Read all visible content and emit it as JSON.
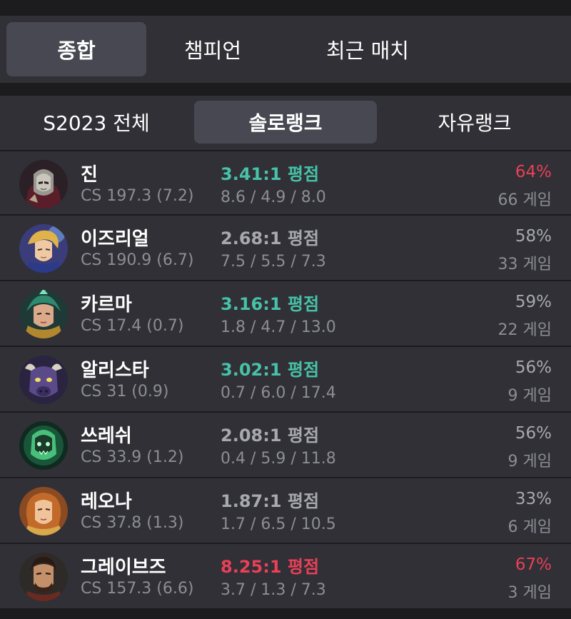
{
  "main_tabs": [
    {
      "label": "종합",
      "active": true
    },
    {
      "label": "챔피언",
      "active": false
    },
    {
      "label": "최근 매치",
      "active": false
    }
  ],
  "sub_tabs": [
    {
      "label": "S2023 전체",
      "active": false
    },
    {
      "label": "솔로랭크",
      "active": true
    },
    {
      "label": "자유랭크",
      "active": false
    }
  ],
  "colors": {
    "background": "#1c1c1f",
    "panel": "#303036",
    "active_tab": "#484852",
    "kda_good": "#47c1a8",
    "kda_great": "#e84057",
    "winrate_high": "#e84057",
    "muted": "#8d8d96"
  },
  "champions": [
    {
      "name": "진",
      "cs": "CS 197.3 (7.2)",
      "kda_ratio": "3.41:1 평점",
      "kda_tier": "high",
      "kda": "8.6 / 4.9 / 8.0",
      "winrate": "64%",
      "winrate_hot": true,
      "games": "66 게임",
      "icon": "jhin-portrait"
    },
    {
      "name": "이즈리얼",
      "cs": "CS 190.9 (6.7)",
      "kda_ratio": "2.68:1 평점",
      "kda_tier": "normal",
      "kda": "7.5 / 5.5 / 7.3",
      "winrate": "58%",
      "winrate_hot": false,
      "games": "33 게임",
      "icon": "ezreal-portrait"
    },
    {
      "name": "카르마",
      "cs": "CS 17.4 (0.7)",
      "kda_ratio": "3.16:1 평점",
      "kda_tier": "high",
      "kda": "1.8 / 4.7 / 13.0",
      "winrate": "59%",
      "winrate_hot": false,
      "games": "22 게임",
      "icon": "karma-portrait"
    },
    {
      "name": "알리스타",
      "cs": "CS 31 (0.9)",
      "kda_ratio": "3.02:1 평점",
      "kda_tier": "high",
      "kda": "0.7 / 6.0 / 17.4",
      "winrate": "56%",
      "winrate_hot": false,
      "games": "9 게임",
      "icon": "alistar-portrait"
    },
    {
      "name": "쓰레쉬",
      "cs": "CS 33.9 (1.2)",
      "kda_ratio": "2.08:1 평점",
      "kda_tier": "normal",
      "kda": "0.4 / 5.9 / 11.8",
      "winrate": "56%",
      "winrate_hot": false,
      "games": "9 게임",
      "icon": "thresh-portrait"
    },
    {
      "name": "레오나",
      "cs": "CS 37.8 (1.3)",
      "kda_ratio": "1.87:1 평점",
      "kda_tier": "normal",
      "kda": "1.7 / 6.5 / 10.5",
      "winrate": "33%",
      "winrate_hot": false,
      "games": "6 게임",
      "icon": "leona-portrait"
    },
    {
      "name": "그레이브즈",
      "cs": "CS 157.3 (6.6)",
      "kda_ratio": "8.25:1 평점",
      "kda_tier": "great",
      "kda": "3.7 / 1.3 / 7.3",
      "winrate": "67%",
      "winrate_hot": true,
      "games": "3 게임",
      "icon": "graves-portrait"
    }
  ]
}
